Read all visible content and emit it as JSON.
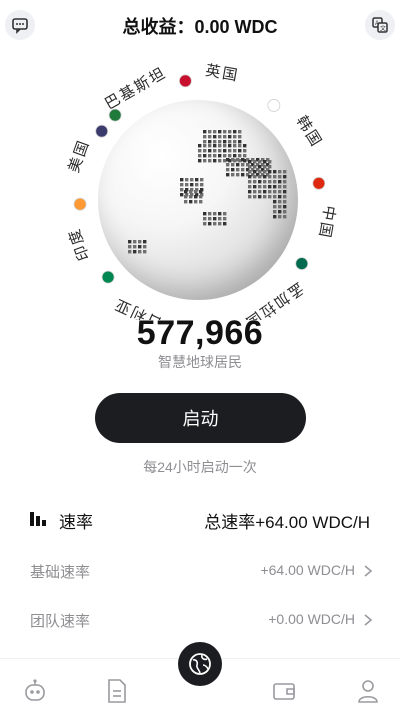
{
  "header": {
    "title": "总收益：0.00 WDC",
    "left_icon": "chat-icon",
    "right_icon": "translate-icon"
  },
  "globe": {
    "countries": [
      {
        "name": "巴基斯坦",
        "flag": "pakistan"
      },
      {
        "name": "英国",
        "flag": "uk"
      },
      {
        "name": "韩国",
        "flag": "south-korea"
      },
      {
        "name": "中国",
        "flag": "china"
      },
      {
        "name": "孟加拉国",
        "flag": "bangladesh"
      },
      {
        "name": "尼日利亚",
        "flag": "nigeria"
      },
      {
        "name": "印度",
        "flag": "india"
      },
      {
        "name": "美国",
        "flag": "usa"
      }
    ]
  },
  "residents": {
    "count": "577,966",
    "label": "智慧地球居民"
  },
  "start": {
    "button_label": "启动",
    "hint": "每24小时启动一次"
  },
  "rates": {
    "title": "速率",
    "total": "总速率+64.00 WDC/H",
    "rows": [
      {
        "label": "基础速率",
        "value": "+64.00 WDC/H"
      },
      {
        "label": "团队速率",
        "value": "+0.00 WDC/H"
      }
    ]
  },
  "tabbar": {
    "tabs": [
      "robot-icon",
      "document-icon",
      "globe-icon",
      "wallet-icon",
      "profile-icon"
    ]
  },
  "colors": {
    "primary_dark": "#1c1d20",
    "muted_text": "#8e8e93"
  }
}
